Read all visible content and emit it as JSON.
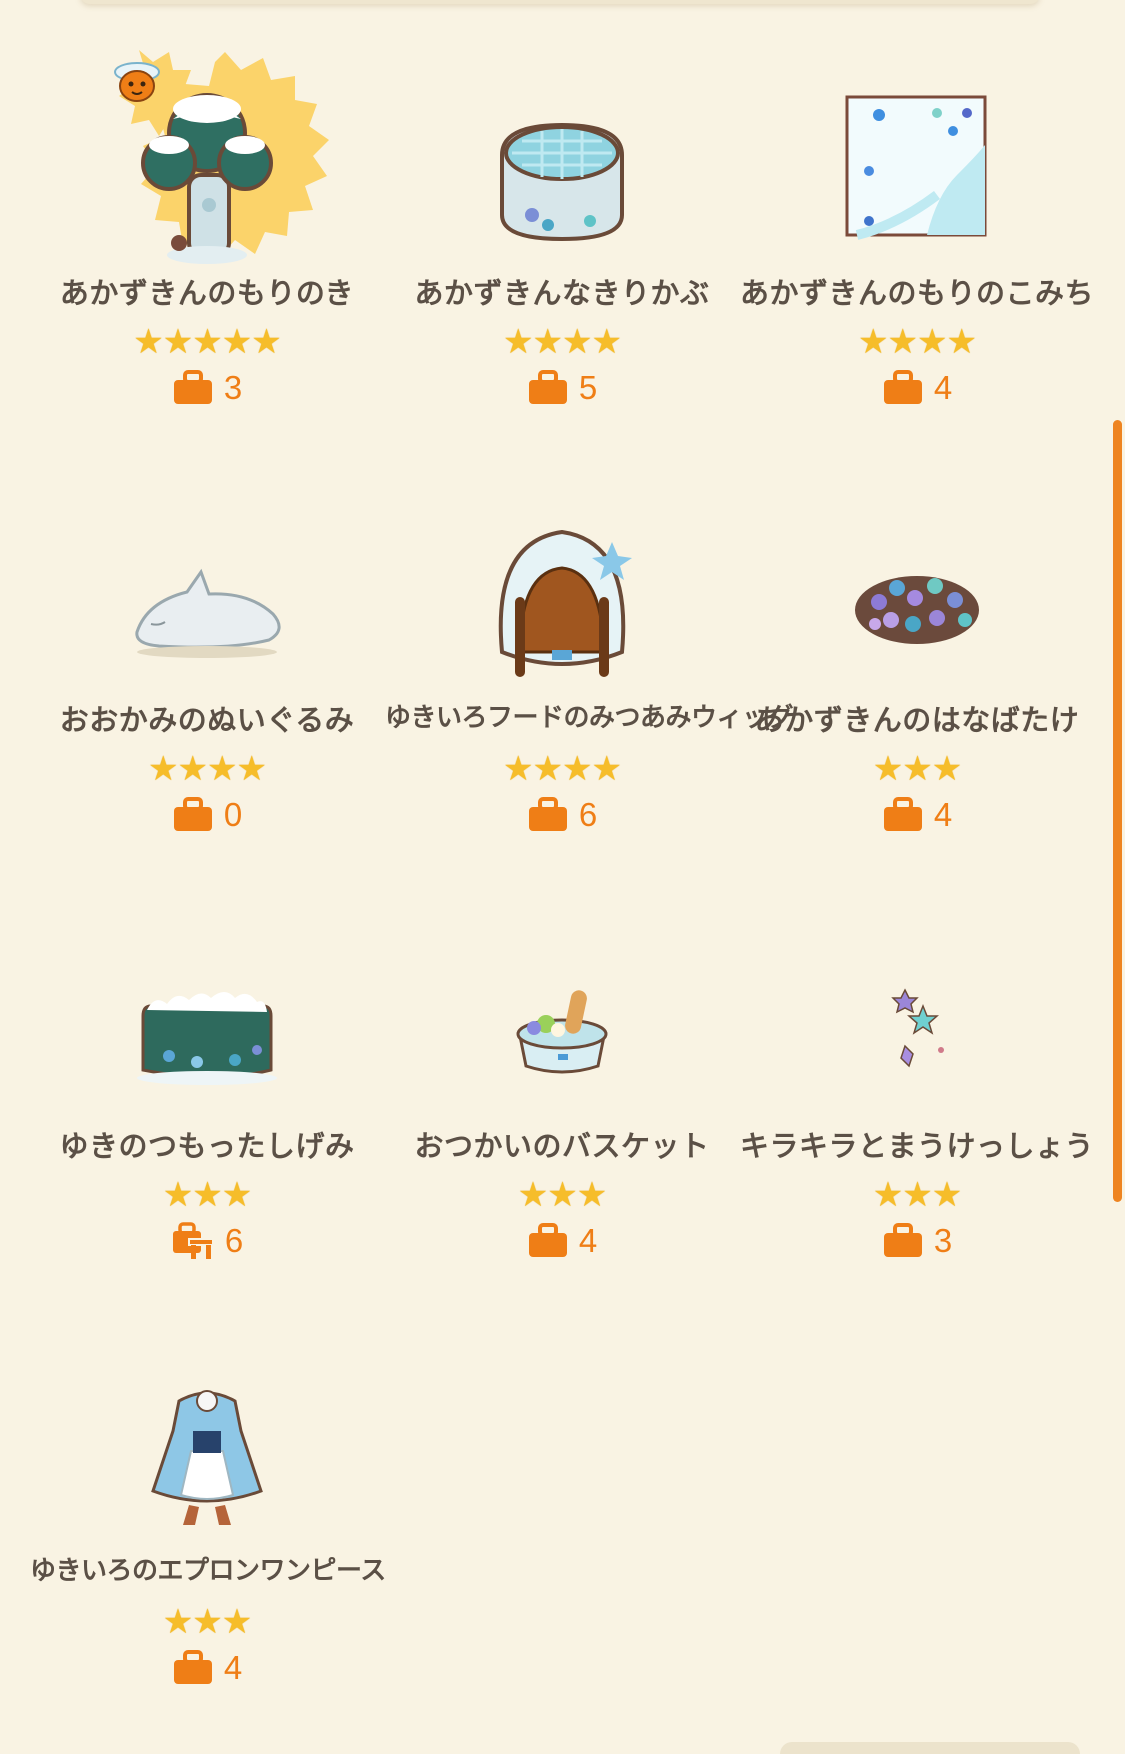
{
  "colors": {
    "background": "#f9f3e3",
    "name_text": "#5b5046",
    "star": "#f6bd2a",
    "count_accent": "#ef7e16",
    "scrollbar": "#ee8421"
  },
  "items": [
    {
      "name": "あかずきんのもりのき",
      "stars": "★★★★★",
      "rating": 5,
      "count": "3",
      "count_icon": "bag-icon",
      "thumb_icon": "snowy-tree-icon",
      "featured": true
    },
    {
      "name": "あかずきんなきりかぶ",
      "stars": "★★★★",
      "rating": 4,
      "count": "5",
      "count_icon": "bag-icon",
      "thumb_icon": "tree-stump-table-icon"
    },
    {
      "name": "あかずきんのもりのこみち",
      "stars": "★★★★",
      "rating": 4,
      "count": "4",
      "count_icon": "bag-icon",
      "thumb_icon": "forest-path-floor-icon"
    },
    {
      "name": "おおかみのぬいぐるみ",
      "stars": "★★★★",
      "rating": 4,
      "count": "0",
      "count_icon": "bag-icon",
      "thumb_icon": "wolf-plush-icon"
    },
    {
      "name": "ゆきいろフードのみつあみウィッグ",
      "stars": "★★★★",
      "rating": 4,
      "count": "6",
      "count_icon": "bag-icon",
      "thumb_icon": "hood-wig-icon"
    },
    {
      "name": "あかずきんのはなばたけ",
      "stars": "★★★",
      "rating": 3,
      "count": "4",
      "count_icon": "bag-icon",
      "thumb_icon": "flower-bed-icon"
    },
    {
      "name": "ゆきのつもったしげみ",
      "stars": "★★★",
      "rating": 3,
      "count": "6",
      "count_icon": "furniture-bag-icon",
      "thumb_icon": "snowy-hedge-icon"
    },
    {
      "name": "おつかいのバスケット",
      "stars": "★★★",
      "rating": 3,
      "count": "4",
      "count_icon": "bag-icon",
      "thumb_icon": "basket-icon"
    },
    {
      "name": "キラキラとまうけっしょう",
      "stars": "★★★",
      "rating": 3,
      "count": "3",
      "count_icon": "bag-icon",
      "thumb_icon": "snow-crystals-icon"
    },
    {
      "name": "ゆきいろのエプロンワンピース",
      "stars": "★★★",
      "rating": 3,
      "count": "4",
      "count_icon": "bag-icon",
      "thumb_icon": "apron-dress-icon"
    }
  ]
}
